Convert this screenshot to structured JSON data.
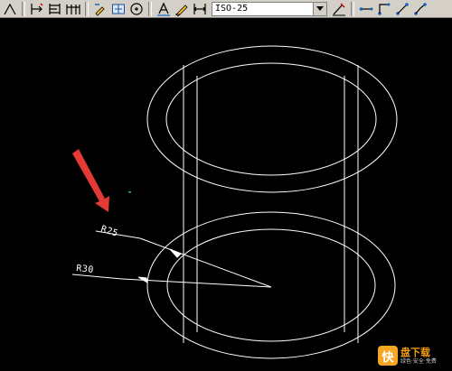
{
  "toolbar": {
    "icons": [
      "dim-linear-icon",
      "dim-aligned-icon",
      "dim-baseline-icon",
      "dim-continue-icon",
      "dim-edit-icon",
      "dim-tolerance-icon",
      "center-mark-icon",
      "dim-text-edit-icon",
      "dim-update-icon",
      "dim-style-icon",
      "leader-icon",
      "ordinate-icon",
      "arc-length-icon",
      "jogged-icon"
    ],
    "dim_style": "ISO-25"
  },
  "drawing": {
    "dimensions": [
      {
        "text": "R25"
      },
      {
        "text": "R30"
      }
    ],
    "colors": {
      "background": "#000000",
      "lines": "#ffffff",
      "arrow": "#e53935"
    }
  },
  "watermark": {
    "logo_char": "快",
    "title": "盘下载",
    "subtitle": "绿色·安全·免费"
  }
}
